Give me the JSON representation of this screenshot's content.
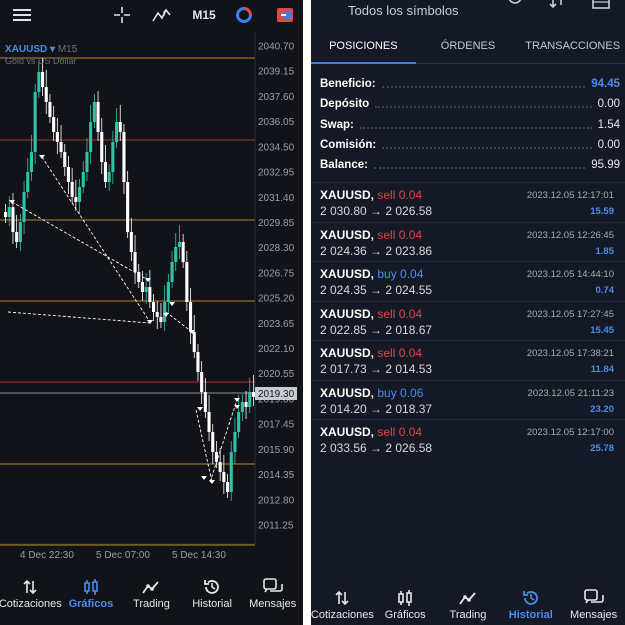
{
  "chart_panel": {
    "timeframe": "M15",
    "symbol": "XAUUSD",
    "symbol_timeframe": "M15",
    "symbol_description": "Gold vs US Dollar",
    "price_levels": [
      "2040.70",
      "2039.15",
      "2037.60",
      "2036.05",
      "2034.50",
      "2032.95",
      "2031.40",
      "2029.85",
      "2028.30",
      "2026.75",
      "2025.20",
      "2023.65",
      "2022.10",
      "2020.55",
      "2019.00",
      "2017.45",
      "2015.90",
      "2014.35",
      "2012.80",
      "2011.25"
    ],
    "current_price": "2019.30",
    "time_labels": [
      "4 Dec 22:30",
      "5 Dec 07:00",
      "5 Dec 14:30"
    ]
  },
  "left_nav": [
    {
      "label": "Cotizaciones",
      "icon": "sort-arrows-icon"
    },
    {
      "label": "Gráficos",
      "icon": "candles-icon",
      "active": true
    },
    {
      "label": "Trading",
      "icon": "trend-icon"
    },
    {
      "label": "Historial",
      "icon": "history-icon"
    },
    {
      "label": "Mensajes",
      "icon": "messages-icon"
    }
  ],
  "history_panel": {
    "header_title": "Todos los símbolos",
    "tabs": [
      "POSICIONES",
      "ÓRDENES",
      "TRANSACCIONES"
    ],
    "summary": [
      {
        "label": "Beneficio:",
        "value": "94.45"
      },
      {
        "label": "Depósito",
        "value": "0.00"
      },
      {
        "label": "Swap:",
        "value": "1.54"
      },
      {
        "label": "Comisión:",
        "value": "0.00"
      },
      {
        "label": "Balance:",
        "value": "95.99"
      }
    ],
    "deals": [
      {
        "symbol": "XAUUSD,",
        "side": "sell 0.04",
        "type": "sell",
        "prices": "2 030.80 → 2 026.58",
        "time": "2023.12.05 12:17:01",
        "profit": "15.59"
      },
      {
        "symbol": "XAUUSD,",
        "side": "sell 0.04",
        "type": "sell",
        "prices": "2 024.36 → 2 023.86",
        "time": "2023.12.05 12:26:45",
        "profit": "1.85"
      },
      {
        "symbol": "XAUUSD,",
        "side": "buy 0.04",
        "type": "buy",
        "prices": "2 024.35 → 2 024.55",
        "time": "2023.12.05 14:44:10",
        "profit": "0.74"
      },
      {
        "symbol": "XAUUSD,",
        "side": "sell 0.04",
        "type": "sell",
        "prices": "2 022.85 → 2 018.67",
        "time": "2023.12.05 17:27:45",
        "profit": "15.45"
      },
      {
        "symbol": "XAUUSD,",
        "side": "sell 0.04",
        "type": "sell",
        "prices": "2 017.73 → 2 014.53",
        "time": "2023.12.05 17:38:21",
        "profit": "11.84"
      },
      {
        "symbol": "XAUUSD,",
        "side": "buy 0.06",
        "type": "buy",
        "prices": "2 014.20 → 2 018.37",
        "time": "2023.12.05 21:11:23",
        "profit": "23.20"
      },
      {
        "symbol": "XAUUSD,",
        "side": "sell 0.04",
        "type": "sell",
        "prices": "2 033.56 → 2 026.58",
        "time": "2023.12.05 12:17:00",
        "profit": "25.78"
      }
    ]
  },
  "right_nav": [
    {
      "label": "Cotizaciones",
      "icon": "sort-arrows-icon"
    },
    {
      "label": "Gráficos",
      "icon": "candles-icon"
    },
    {
      "label": "Trading",
      "icon": "trend-icon"
    },
    {
      "label": "Historial",
      "icon": "history-icon",
      "active": true
    },
    {
      "label": "Mensajes",
      "icon": "messages-icon"
    }
  ],
  "colors": {
    "accent": "#4a8df0",
    "sell": "#e04848",
    "bull_candle": "#2ec4a6",
    "bear_candle": "#ffffff"
  }
}
